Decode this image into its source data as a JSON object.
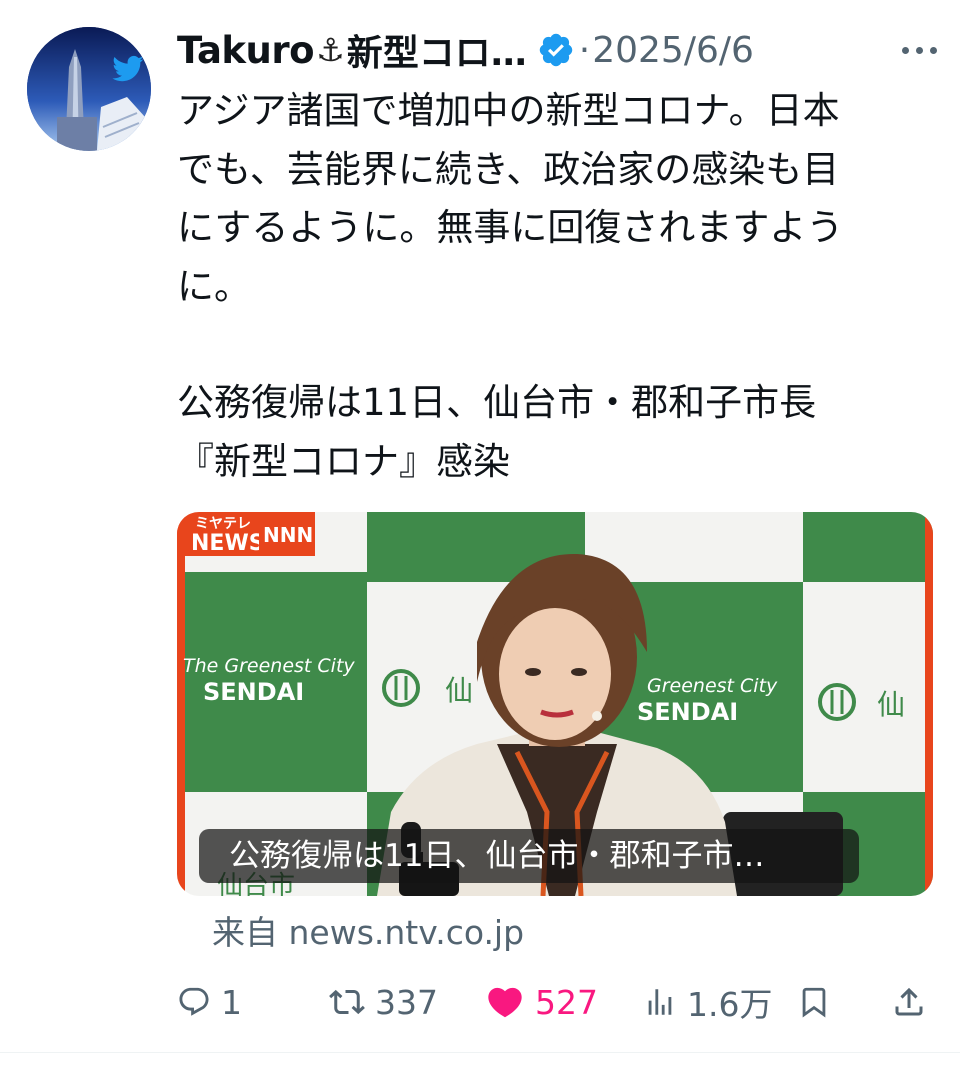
{
  "tweet": {
    "author_name": "Takuro",
    "anchor_glyph": "⚓",
    "author_name_suffix": "新型コロ…",
    "separator": "·",
    "date": "2025/6/6",
    "text_lines": [
      "アジア諸国で増加中の新型コロナ。日本",
      "でも、芸能界に続き、政治家の感染も目",
      "にするように。無事に回復されますよう",
      "に。"
    ],
    "headline_lines": [
      "公務復帰は11日、仙台市・郡和子市長",
      "『新型コロナ』感染"
    ],
    "media": {
      "caption": "公務復帰は11日、仙台市・郡和子市…",
      "logo_top": "ミヤテレ",
      "logo_news": "NEWS",
      "logo_nnn": "NNN",
      "backdrop_line1": "The Greenest City",
      "backdrop_line2": "SENDAI",
      "backdrop_line3": "Greenest City",
      "backdrop_line4": "SENDAI",
      "backdrop_char": "仙",
      "backdrop_bottom": "仙台市"
    },
    "source": "来自 news.ntv.co.jp",
    "actions": {
      "reply_count": "1",
      "retweet_count": "337",
      "like_count": "527",
      "views_count": "1.6万"
    }
  },
  "colors": {
    "accent": "#1d9bf0",
    "like": "#f91880",
    "muted": "#536471",
    "sendai_green": "#3f8a4a",
    "badge_red": "#e8451c"
  },
  "icons": [
    "more-icon",
    "verified-badge-icon",
    "reply-icon",
    "retweet-icon",
    "like-icon",
    "views-icon",
    "bookmark-icon",
    "share-icon"
  ]
}
